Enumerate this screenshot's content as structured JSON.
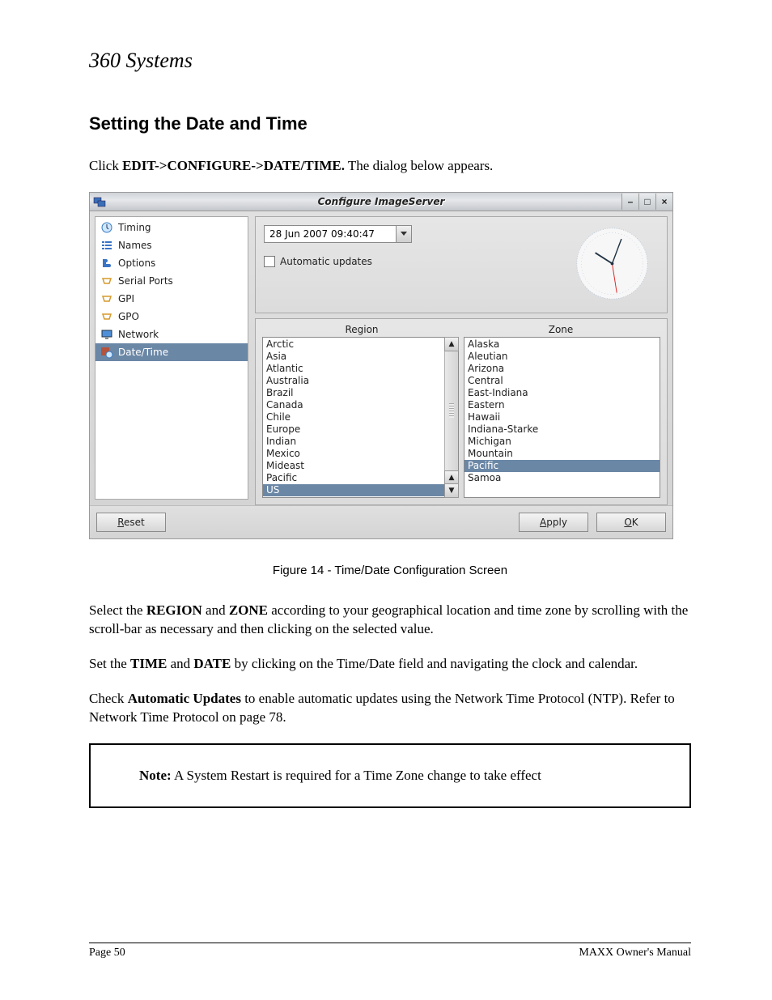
{
  "logo_text": "360 Systems",
  "section_title": "Setting the Date and Time",
  "intro_pre": "Click ",
  "intro_bold": "EDIT->CONFIGURE->DATE/TIME.",
  "intro_post": " The dialog below appears.",
  "window": {
    "title": "Configure ImageServer",
    "sidebar": [
      {
        "label": "Timing"
      },
      {
        "label": "Names"
      },
      {
        "label": "Options"
      },
      {
        "label": "Serial Ports"
      },
      {
        "label": "GPI"
      },
      {
        "label": "GPO"
      },
      {
        "label": "Network"
      },
      {
        "label": "Date/Time"
      }
    ],
    "sidebar_selected_index": 7,
    "datetime_value": "28 Jun 2007 09:40:47",
    "auto_updates_label": "Automatic updates",
    "region_header": "Region",
    "zone_header": "Zone",
    "regions": [
      "Arctic",
      "Asia",
      "Atlantic",
      "Australia",
      "Brazil",
      "Canada",
      "Chile",
      "Europe",
      "Indian",
      "Mexico",
      "Mideast",
      "Pacific",
      "US"
    ],
    "region_selected": "US",
    "zones": [
      "Alaska",
      "Aleutian",
      "Arizona",
      "Central",
      "East-Indiana",
      "Eastern",
      "Hawaii",
      "Indiana-Starke",
      "Michigan",
      "Mountain",
      "Pacific",
      "Samoa"
    ],
    "zone_selected": "Pacific",
    "reset_label": "Reset",
    "apply_label": "Apply",
    "ok_label": "OK"
  },
  "figure_caption": "Figure 14 - Time/Date Configuration Screen",
  "para2_a": "Select the ",
  "para2_b1": "REGION",
  "para2_c": " and ",
  "para2_b2": "ZONE",
  "para2_d": " according to your geographical location and time zone by scrolling with the scroll-bar as necessary and then clicking on the selected value.",
  "para3_a": "Set the ",
  "para3_b1": "TIME",
  "para3_c": " and ",
  "para3_b2": "DATE",
  "para3_d": " by clicking on the Time/Date field and navigating the clock and calendar.",
  "para4_a": "Check ",
  "para4_b": "Automatic Updates",
  "para4_c": " to enable automatic updates using the Network Time Protocol (NTP). Refer to Network Time Protocol on page 78.",
  "note_b": "Note:",
  "note_t": " A System Restart is required for a Time Zone change to take effect",
  "footer_left": "Page 50",
  "footer_right": "MAXX Owner's Manual"
}
